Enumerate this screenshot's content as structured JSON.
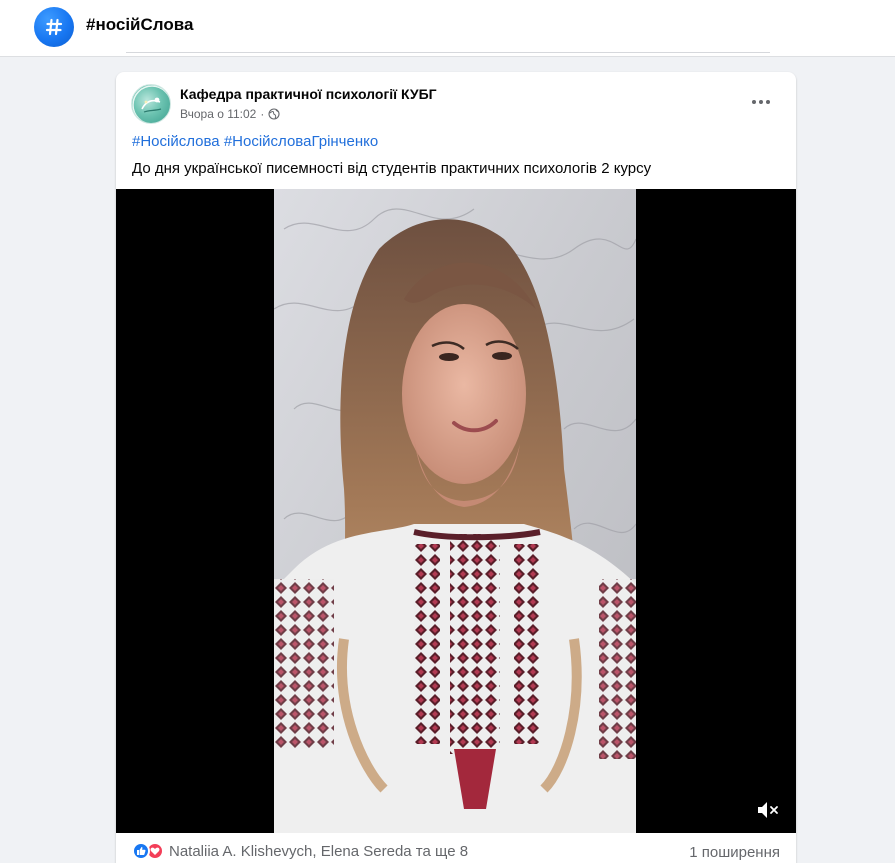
{
  "header": {
    "hashtag_title": "#носійСлова",
    "hashtag_icon": "hash-icon",
    "accent_color": "#1877f2"
  },
  "post": {
    "author": "Кафедра практичної психології КУБГ",
    "timestamp": "Вчора о 11:02",
    "separator": "·",
    "privacy_icon": "globe-icon",
    "hashtags": [
      "#Носійслова",
      "#НосійсловаГрінченко"
    ],
    "text": "До дня української писемності від студентів практичних психологів 2 курсу",
    "more_icon": "more-horizontal-icon",
    "video": {
      "muted": true,
      "mute_icon": "volume-muted-icon"
    },
    "reactions": {
      "types": [
        "like",
        "love"
      ],
      "names": "Nataliia A. Klishevych, Elena Sereda та ще 8"
    },
    "shares": "1 поширення",
    "link_color": "#216fdb"
  }
}
